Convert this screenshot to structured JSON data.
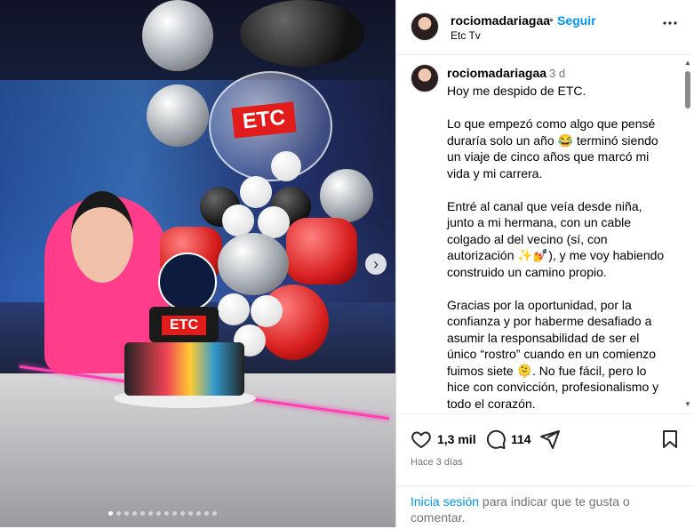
{
  "post": {
    "image_alt": "",
    "carousel": {
      "total": 14,
      "active": 0
    },
    "next_arrow": "›",
    "cake_logo": "ETC",
    "balloon_logo": "ETC"
  },
  "header": {
    "username": "rociomadariagaa",
    "separator": "•",
    "follow_label": "Seguir",
    "subtitle": "Etc Tv",
    "more_label": "•••"
  },
  "caption": {
    "username": "rociomadariagaa",
    "time": "3 d",
    "paragraphs": [
      "Hoy me despido de ETC.",
      "Lo que empezó como algo que pensé duraría solo un año 😂 terminó siendo un viaje de cinco años que marcó mi vida y mi carrera.",
      "Entré al canal que veía desde niña, junto a mi hermana, con un cable colgado al del vecino (sí, con autorización ✨💅), y me voy habiendo construido un camino propio.",
      "Gracias por la oportunidad, por la confianza y por haberme desafiado a asumir la responsabilidad de ser el único “rostro” cuando en un comienzo fuimos siete 🫠. No fue fácil, pero lo hice con convicción, profesionalismo y todo el corazón."
    ]
  },
  "actions": {
    "likes": "1,3 mil",
    "comments": "114",
    "time_ago": "Hace 3 días"
  },
  "login": {
    "link": "Inicia sesión",
    "text": " para indicar que te gusta o comentar."
  },
  "colors": {
    "link": "#0095f6",
    "secondary_text": "#737373"
  }
}
